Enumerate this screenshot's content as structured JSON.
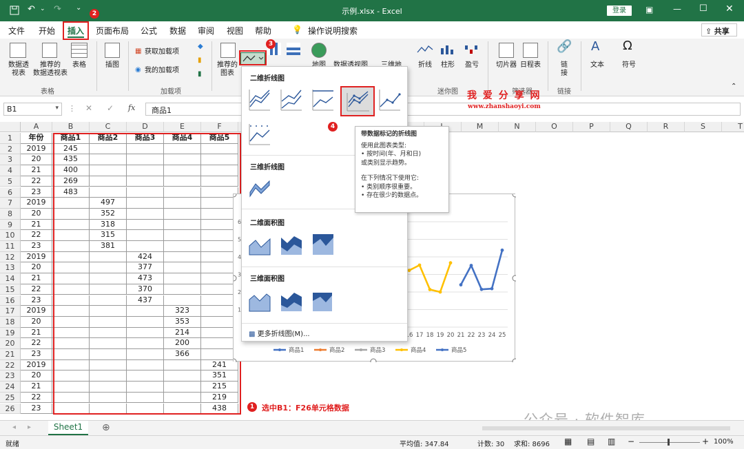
{
  "window": {
    "title": "示例.xlsx - Excel",
    "login": "登录",
    "share": "共享"
  },
  "tabs": [
    "文件",
    "开始",
    "插入",
    "页面布局",
    "公式",
    "数据",
    "审阅",
    "视图",
    "帮助"
  ],
  "tell_me": "操作说明搜索",
  "ribbon": {
    "pivot": "数据透\n视表",
    "recommended_pivot": "推荐的\n数据透视表",
    "table": "表格",
    "illustrations": "插图",
    "get_addins": "获取加载项",
    "my_addins": "我的加载项",
    "recommended_charts": "推荐的\n图表",
    "maps": "地图",
    "pivot_chart": "数据透视图",
    "threed_map": "三维地\n图",
    "sparkline_line": "折线",
    "sparkline_column": "柱形",
    "sparkline_winloss": "盈亏",
    "slicer": "切片器",
    "timeline": "日程表",
    "link": "链\n接",
    "text": "文本",
    "symbol": "符号",
    "groups": {
      "tables": "表格",
      "addins": "加载项",
      "sparklines": "迷你图",
      "filters": "筛选器",
      "links": "链接"
    }
  },
  "formula_bar": {
    "cell_ref": "B1",
    "value": "商品1"
  },
  "watermark": {
    "line1": "我 爱 分 享 网",
    "line2": "www.zhanshaoyi.com",
    "bottom": "公众号 · 软件智库"
  },
  "columns": [
    "A",
    "B",
    "C",
    "D",
    "E",
    "F",
    "G",
    "H",
    "I",
    "J",
    "K",
    "L",
    "M",
    "N",
    "O",
    "P",
    "Q",
    "R",
    "S",
    "T"
  ],
  "rows": [
    [
      "年份",
      "商品1",
      "商品2",
      "商品3",
      "商品4",
      "商品5"
    ],
    [
      "2019",
      "245",
      "",
      "",
      "",
      ""
    ],
    [
      "20",
      "435",
      "",
      "",
      "",
      ""
    ],
    [
      "21",
      "400",
      "",
      "",
      "",
      ""
    ],
    [
      "22",
      "269",
      "",
      "",
      "",
      ""
    ],
    [
      "23",
      "483",
      "",
      "",
      "",
      ""
    ],
    [
      "2019",
      "",
      "497",
      "",
      "",
      ""
    ],
    [
      "20",
      "",
      "352",
      "",
      "",
      ""
    ],
    [
      "21",
      "",
      "318",
      "",
      "",
      ""
    ],
    [
      "22",
      "",
      "315",
      "",
      "",
      ""
    ],
    [
      "23",
      "",
      "381",
      "",
      "",
      ""
    ],
    [
      "2019",
      "",
      "",
      "424",
      "",
      ""
    ],
    [
      "20",
      "",
      "",
      "377",
      "",
      ""
    ],
    [
      "21",
      "",
      "",
      "473",
      "",
      ""
    ],
    [
      "22",
      "",
      "",
      "370",
      "",
      ""
    ],
    [
      "23",
      "",
      "",
      "437",
      "",
      ""
    ],
    [
      "2019",
      "",
      "",
      "",
      "323",
      ""
    ],
    [
      "20",
      "",
      "",
      "",
      "353",
      ""
    ],
    [
      "21",
      "",
      "",
      "",
      "214",
      ""
    ],
    [
      "22",
      "",
      "",
      "",
      "200",
      ""
    ],
    [
      "23",
      "",
      "",
      "",
      "366",
      ""
    ],
    [
      "2019",
      "",
      "",
      "",
      "",
      "241"
    ],
    [
      "20",
      "",
      "",
      "",
      "",
      "351"
    ],
    [
      "21",
      "",
      "",
      "",
      "",
      "215"
    ],
    [
      "22",
      "",
      "",
      "",
      "",
      "219"
    ],
    [
      "23",
      "",
      "",
      "",
      "",
      "438"
    ]
  ],
  "dropdown": {
    "section_2d_line": "二维折线图",
    "section_3d_line": "三维折线图",
    "section_2d_area": "二维面积图",
    "section_3d_area": "三维面积图",
    "more": "更多折线图(M)..."
  },
  "tooltip": {
    "title": "带数据标记的折线图",
    "l1": "使用此图表类型:",
    "l2": "• 按时间(年、月和日)",
    "l3": "或类别显示趋势。",
    "l4": "在下列情况下使用它:",
    "l5": "• 类别顺序很重要。",
    "l6": "• 存在很少的数据点。"
  },
  "chart_data": {
    "type": "line",
    "x_ticks_visible": [
      "16",
      "17",
      "18",
      "19",
      "20",
      "21",
      "22",
      "23",
      "24",
      "25"
    ],
    "y_ticks_visible": [
      "6",
      "5",
      "4",
      "3",
      "2",
      "1"
    ],
    "series": [
      {
        "name": "商品1",
        "color": "#4472c4"
      },
      {
        "name": "商品2",
        "color": "#ed7d31"
      },
      {
        "name": "商品3",
        "color": "#a5a5a5"
      },
      {
        "name": "商品4",
        "color": "#ffc000",
        "x": [
          16,
          17,
          18,
          19,
          20
        ],
        "y": [
          323,
          353,
          214,
          200,
          366
        ]
      },
      {
        "name": "商品5",
        "color": "#4472c4",
        "x": [
          21,
          22,
          23,
          24,
          25
        ],
        "y": [
          241,
          351,
          215,
          219,
          438
        ]
      }
    ]
  },
  "annotations": {
    "b1": "1",
    "b2": "2",
    "b3": "3",
    "b4": "4",
    "note": "选中B1：F26单元格数据"
  },
  "sheet_tab": "Sheet1",
  "status": {
    "ready": "就绪",
    "average": "平均值: 347.84",
    "count": "计数: 30",
    "sum": "求和: 8696",
    "zoom": "100%"
  },
  "colors": {
    "excel_green": "#217346",
    "accent_red": "#e02020"
  }
}
